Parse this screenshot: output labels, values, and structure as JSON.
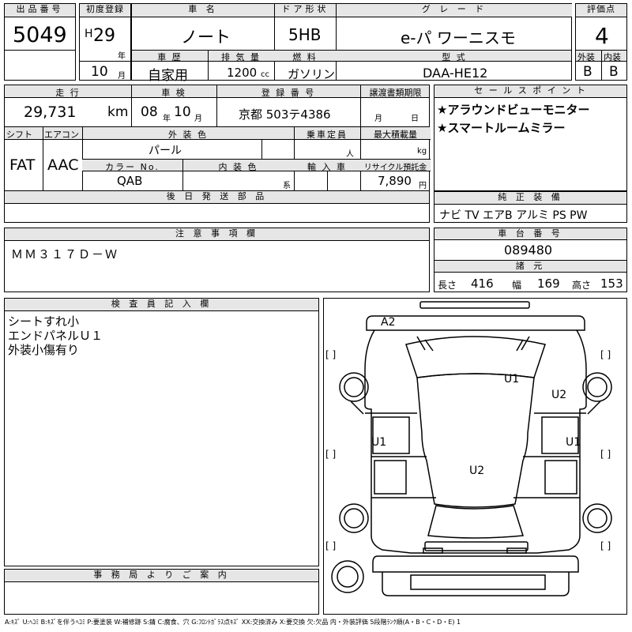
{
  "lot": {
    "label": "出品番号",
    "value": "5049"
  },
  "first_reg": {
    "label": "初度登録",
    "era": "H",
    "year": "29",
    "year_unit": "年",
    "month": "10",
    "month_unit": "月"
  },
  "car_name": {
    "label": "車 名",
    "value": "ノート"
  },
  "door": {
    "label": "ドア形状",
    "value": "5HB"
  },
  "grade": {
    "label": "グ レ ー ド",
    "value": "e-パ ワーニスモ"
  },
  "score": {
    "label": "評価点",
    "value": "4",
    "ext_label": "外装",
    "int_label": "内装",
    "ext": "B",
    "int": "B"
  },
  "history": {
    "label": "車 歴",
    "value": "自家用"
  },
  "displacement": {
    "label": "排 気 量",
    "value": "1200",
    "unit": "cc"
  },
  "fuel": {
    "label": "燃 料",
    "value": "ガソリン"
  },
  "model": {
    "label": "型 式",
    "value": "DAA-HE12"
  },
  "mileage": {
    "label": "走 行",
    "value": "29,731",
    "unit": "km"
  },
  "inspection": {
    "label": "車 検",
    "year": "08",
    "year_unit": "年",
    "month": "10",
    "month_unit": "月"
  },
  "reg_no": {
    "label": "登 録 番 号",
    "value": "京都 503テ4386"
  },
  "transfer": {
    "label": "譲渡書類期限",
    "month_unit": "月",
    "day_unit": "日"
  },
  "sales": {
    "label": "セ ー ル ス ポ イ ン ト",
    "lines": [
      "★アラウンドビューモニター",
      "★スマートルームミラー"
    ]
  },
  "shift": {
    "label": "シフト",
    "value": "FAT"
  },
  "ac": {
    "label": "エアコン",
    "value": "AAC"
  },
  "ext_color": {
    "label": "外 装 色",
    "value": "パール"
  },
  "capacity": {
    "label": "乗車定員",
    "unit": "人"
  },
  "max_load": {
    "label": "最大積載量",
    "unit": "kg"
  },
  "color_no": {
    "label": "カラー No.",
    "value": "QAB"
  },
  "int_color": {
    "label": "内 装 色",
    "unit": "系"
  },
  "import": {
    "label": "輸 入 車"
  },
  "recycle": {
    "label": "リサイクル預託金",
    "value": "7,890",
    "unit": "円"
  },
  "later_parts": {
    "label": "後 日 発 送 部 品"
  },
  "genuine": {
    "label": "純 正 装 備",
    "value": "ナビ TV エアB アルミ PS PW"
  },
  "notes": {
    "label": "注 意 事 項 欄",
    "value": "ＭＭ３１７Ｄ－Ｗ"
  },
  "chassis": {
    "label": "車 台 番 号",
    "value": "089480"
  },
  "dims": {
    "label": "諸 元",
    "len_label": "長さ",
    "len": "416",
    "wid_label": "幅",
    "wid": "169",
    "hgt_label": "高さ",
    "hgt": "153"
  },
  "inspector": {
    "label": "検 査 員 記 入 欄",
    "lines": [
      "シートすれ小",
      "エンドパネルＵ１",
      "外装小傷有り"
    ]
  },
  "office": {
    "label": "事 務 局 よ り ご 案 内"
  },
  "diagram_marks": {
    "a2": "A2",
    "u1_roof": "U1",
    "u2_right": "U2",
    "u1_left": "U1",
    "u1_right": "U1",
    "u2_center": "U2",
    "bracket": "[ ]"
  },
  "legend": "A:ｷｽﾞ U:ﾍｺﾐ B:ｷｽﾞを伴うﾍｺﾐ P:要塗装 W:補修跡 S:錆 C:腐食、穴 G:ﾌﾛﾝﾄｶﾞﾗｽ点ｷｽﾞ XX:交換済み X:要交換 欠:欠品 内・外装評価 5段階ﾗﾝｸ順(A・B・C・D・E) 1"
}
